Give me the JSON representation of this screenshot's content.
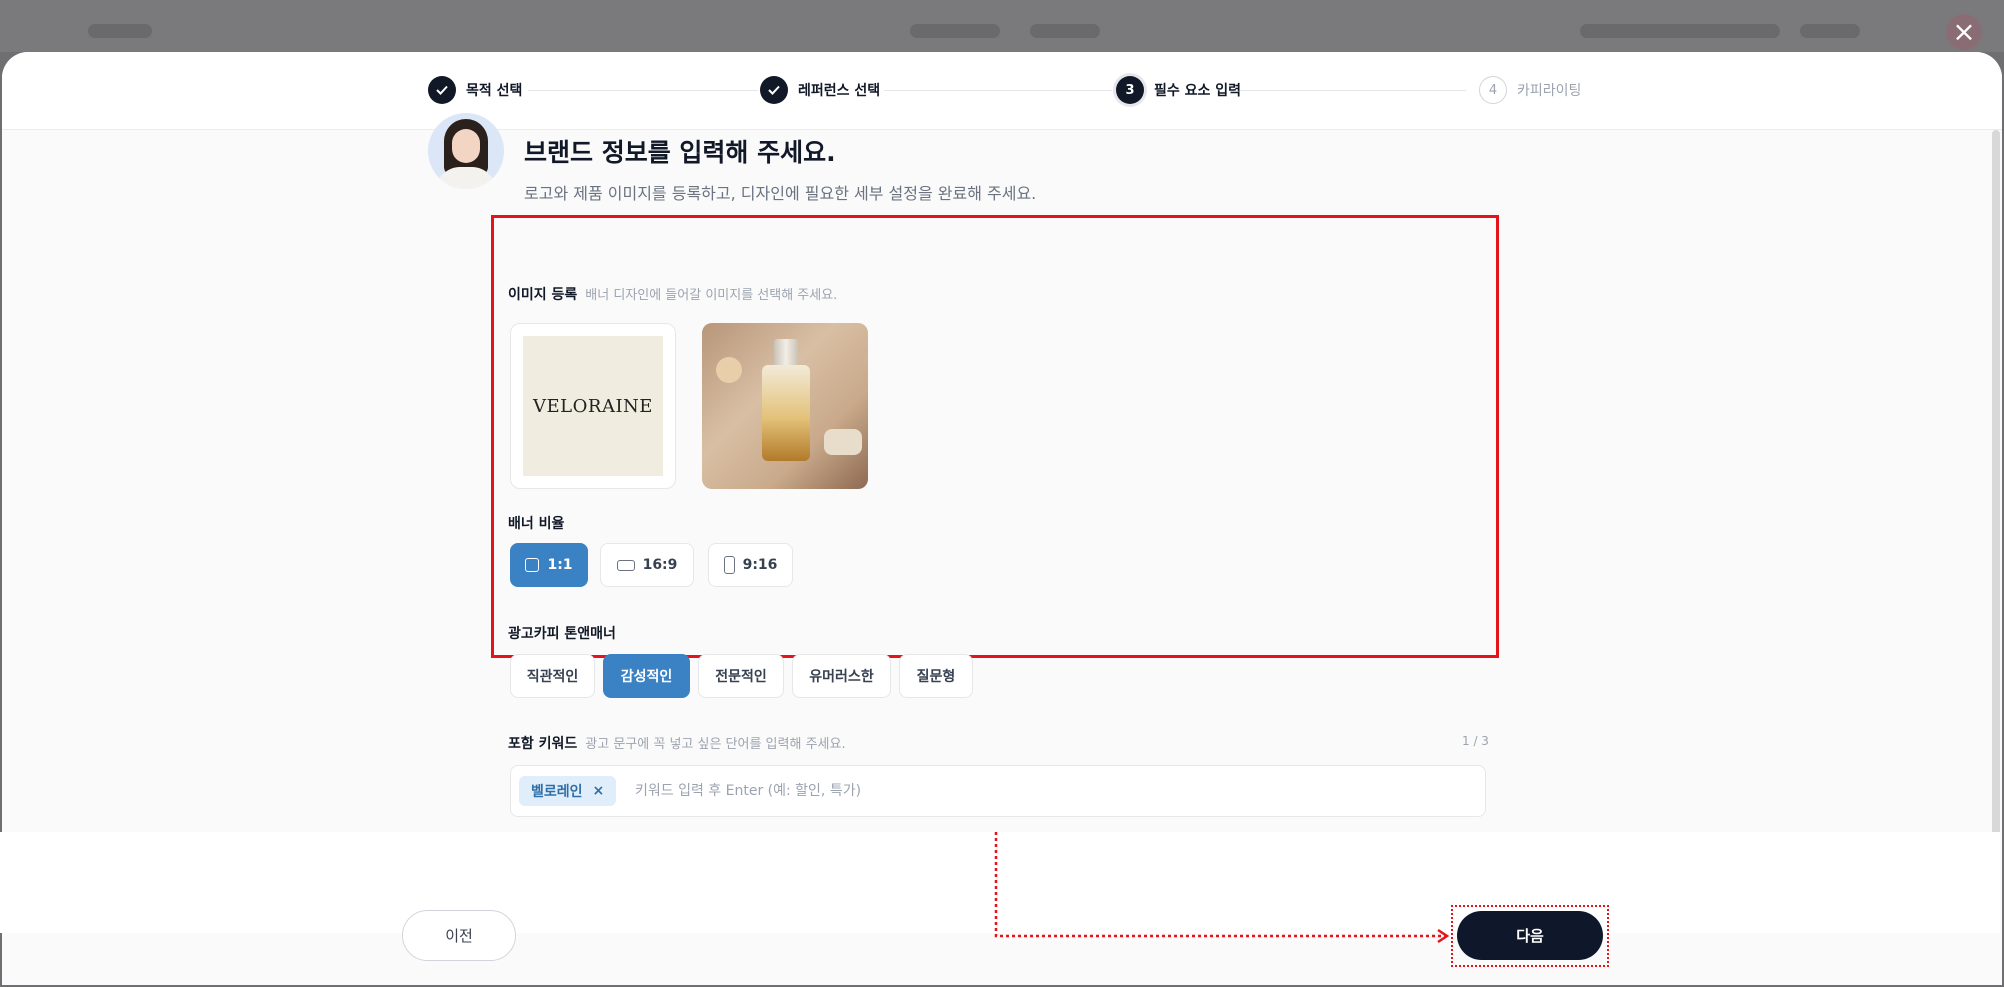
{
  "modal": {
    "close_icon": "close-icon",
    "stepper": {
      "steps": [
        {
          "number": "1",
          "label": "목적 선택",
          "state": "done"
        },
        {
          "number": "2",
          "label": "레퍼런스 선택",
          "state": "done"
        },
        {
          "number": "3",
          "label": "필수 요소 입력",
          "state": "current"
        },
        {
          "number": "4",
          "label": "카피라이팅",
          "state": "todo"
        }
      ]
    },
    "header": {
      "title": "브랜드 정보를 입력해 주세요.",
      "subtitle": "로고와 제품 이미지를 등록하고, 디자인에 필요한 세부 설정을 완료해 주세요."
    },
    "image_section": {
      "title": "이미지 등록",
      "hint": "배너 디자인에 들어갈 이미지를 선택해 주세요.",
      "logo_text": "VELORAINE"
    },
    "ratio_section": {
      "title": "배너 비율",
      "options": [
        {
          "label": "1:1",
          "icon": "square-icon",
          "selected": true
        },
        {
          "label": "16:9",
          "icon": "landscape-icon",
          "selected": false
        },
        {
          "label": "9:16",
          "icon": "portrait-icon",
          "selected": false
        }
      ]
    },
    "tone_section": {
      "title": "광고카피 톤앤매너",
      "options": [
        {
          "label": "직관적인",
          "selected": false
        },
        {
          "label": "감성적인",
          "selected": true
        },
        {
          "label": "전문적인",
          "selected": false
        },
        {
          "label": "유머러스한",
          "selected": false
        },
        {
          "label": "질문형",
          "selected": false
        }
      ]
    },
    "keyword_section": {
      "title": "포함 키워드",
      "hint": "광고 문구에 꼭 넣고 싶은 단어를 입력해 주세요.",
      "counter": "1 / 3",
      "chips": [
        {
          "label": "벨로레인",
          "remove": "×"
        }
      ],
      "placeholder": "키워드 입력 후 Enter (예: 할인, 특가)",
      "value": ""
    },
    "footer": {
      "prev_label": "이전",
      "next_label": "다음"
    }
  },
  "colors": {
    "accent": "#3b82c4",
    "primary_dark": "#0f172a",
    "highlight": "#e5141b"
  }
}
